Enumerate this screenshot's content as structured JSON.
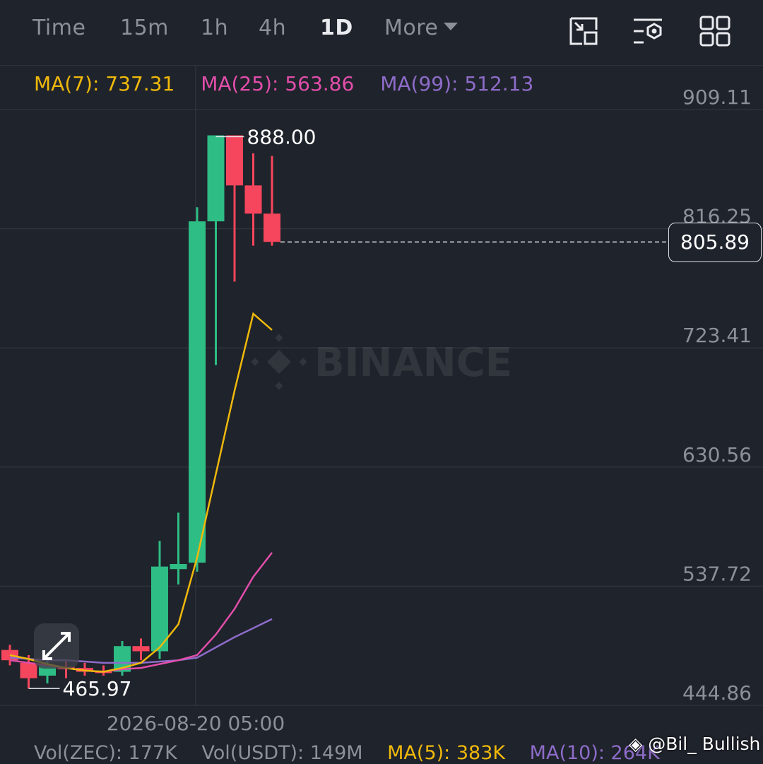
{
  "timeframes": {
    "time": "Time",
    "m15": "15m",
    "h1": "1h",
    "h4": "4h",
    "d1": "1D",
    "more": "More"
  },
  "ma_legend": {
    "ma7": "MA(7): 737.31",
    "ma25": "MA(25): 563.86",
    "ma99": "MA(99): 512.13"
  },
  "colors": {
    "up": "#2ebd85",
    "down": "#f6465d",
    "ma7": "#f0b90b",
    "ma25": "#e14eaa",
    "ma99": "#8e6cc9",
    "grid": "#2e333c",
    "axis_text": "#8b909a"
  },
  "icons": {
    "fullscreen": "fullscreen-icon",
    "indicator": "indicator-settings-icon",
    "layout": "layout-grid-icon",
    "expand": "expand-arrows-icon"
  },
  "chart_data": {
    "type": "candlestick",
    "y_axis_ticks": [
      "909.11",
      "816.25",
      "723.41",
      "630.56",
      "537.72",
      "444.86"
    ],
    "ylim": [
      444.86,
      909.11
    ],
    "x_label": "2026-08-20 05:00",
    "high_label": "888.00",
    "low_label": "465.97",
    "current_price": "805.89",
    "watermark": "BINANCE",
    "candles": [
      {
        "o": 488,
        "h": 492,
        "l": 476,
        "c": 480
      },
      {
        "o": 478,
        "h": 484,
        "l": 458,
        "c": 466
      },
      {
        "o": 468,
        "h": 482,
        "l": 462,
        "c": 476
      },
      {
        "o": 475,
        "h": 479,
        "l": 466,
        "c": 473
      },
      {
        "o": 474,
        "h": 478,
        "l": 468,
        "c": 471
      },
      {
        "o": 472,
        "h": 476,
        "l": 468,
        "c": 470
      },
      {
        "o": 471,
        "h": 495,
        "l": 468,
        "c": 491
      },
      {
        "o": 491,
        "h": 497,
        "l": 480,
        "c": 487
      },
      {
        "o": 487,
        "h": 573,
        "l": 481,
        "c": 553
      },
      {
        "o": 551,
        "h": 595,
        "l": 539,
        "c": 555
      },
      {
        "o": 556,
        "h": 833,
        "l": 549,
        "c": 822
      },
      {
        "o": 822,
        "h": 866,
        "l": 710,
        "c": 889
      },
      {
        "o": 889,
        "h": 888,
        "l": 775,
        "c": 850
      },
      {
        "o": 850,
        "h": 875,
        "l": 803,
        "c": 828
      },
      {
        "o": 828,
        "h": 873,
        "l": 803,
        "c": 806
      }
    ],
    "ma7_series": [
      484,
      481,
      477,
      474,
      472,
      471,
      474,
      478,
      490,
      508,
      560,
      625,
      690,
      750,
      737.31
    ],
    "ma25_series": [
      480,
      478,
      476,
      474,
      472,
      471,
      473,
      474,
      477,
      480,
      484,
      500,
      520,
      545,
      563.86
    ],
    "ma99_series": [
      482,
      481,
      480,
      480,
      479,
      478,
      478,
      478,
      479,
      480,
      482,
      490,
      498,
      505,
      512.13
    ]
  },
  "volume_row": {
    "vol_zec": "Vol(ZEC): 177K",
    "vol_usdt": "Vol(USDT): 149M",
    "ma5": "MA(5): 383K",
    "ma10": "MA(10): 264K"
  },
  "credit": "@Bil_ Bullish"
}
